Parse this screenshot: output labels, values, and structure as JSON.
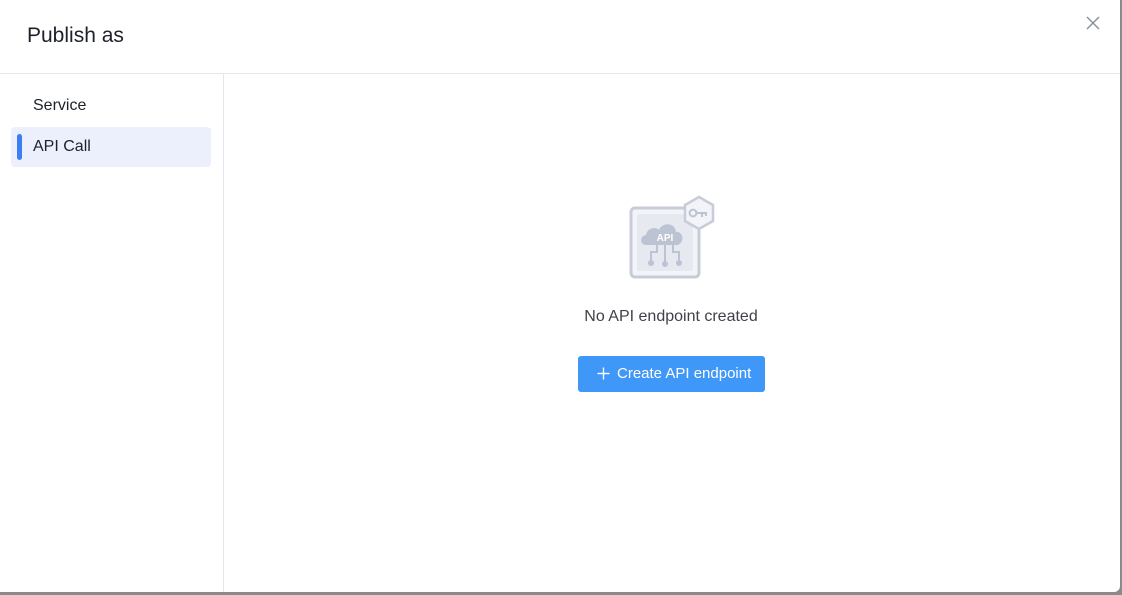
{
  "dialog": {
    "title": "Publish as"
  },
  "sidebar": {
    "items": [
      {
        "label": "Service",
        "active": false
      },
      {
        "label": "API Call",
        "active": true
      }
    ]
  },
  "main": {
    "empty_text": "No API endpoint created",
    "create_button_label": "Create API endpoint",
    "illustration_text": "API"
  },
  "icons": {
    "close": "close-icon",
    "plus": "plus-icon",
    "illustration": "api-endpoint-illustration"
  },
  "colors": {
    "accent": "#3d7ef5",
    "button": "#3f97f7",
    "active_bg": "#ebf0fc"
  }
}
